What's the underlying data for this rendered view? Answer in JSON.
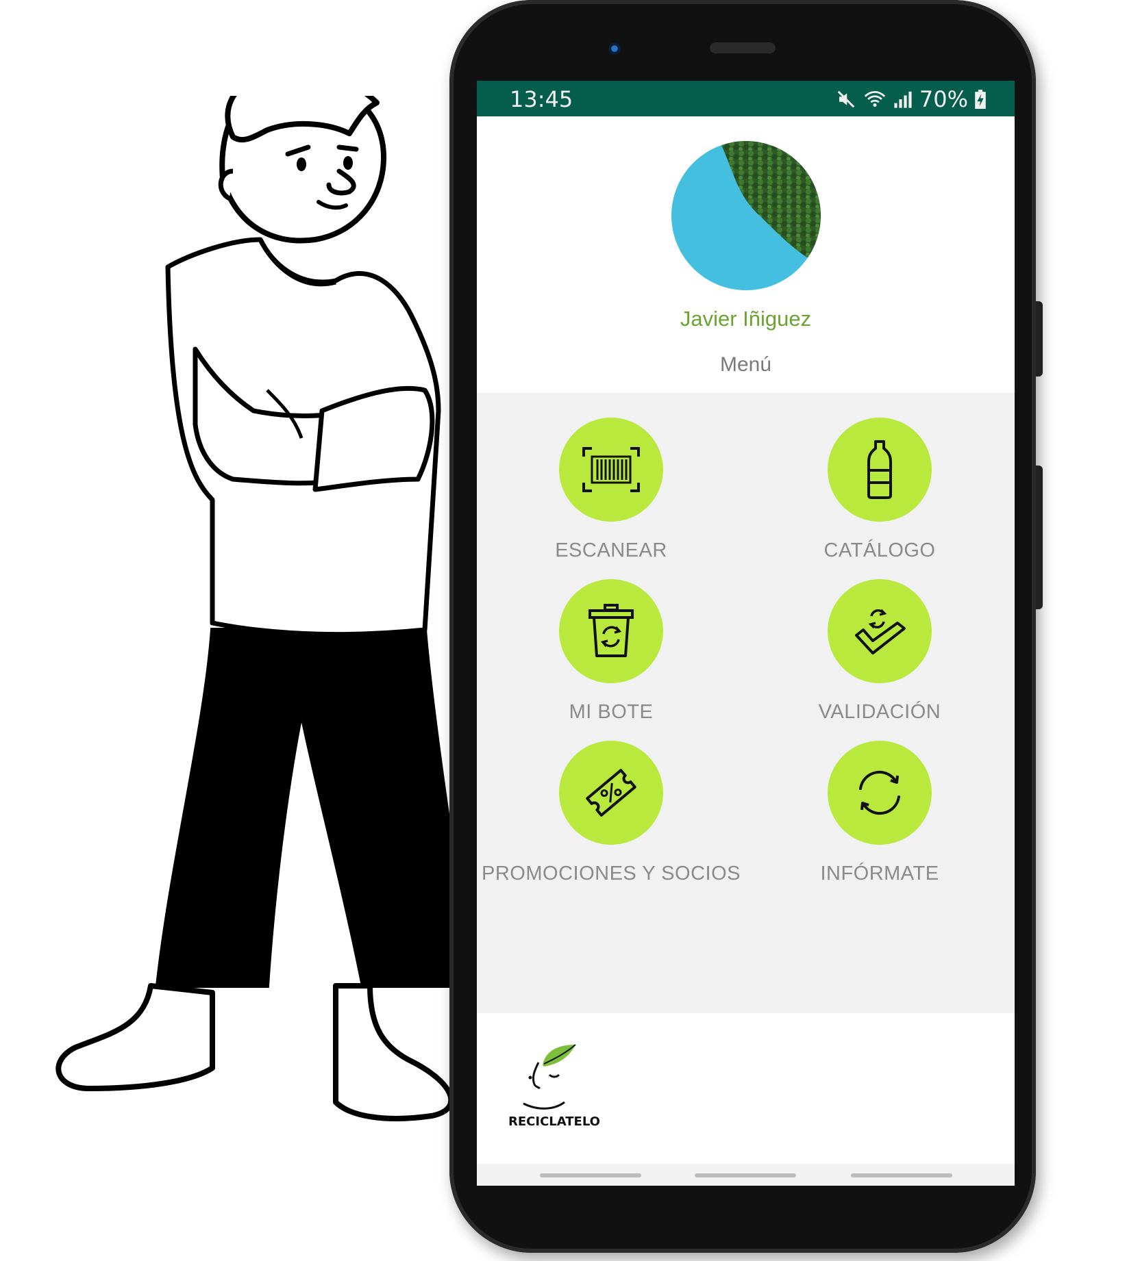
{
  "status_bar": {
    "time": "13:45",
    "battery": "70%",
    "icons": [
      "mute-icon",
      "wifi-icon",
      "signal-icon",
      "battery-charging-icon"
    ]
  },
  "profile": {
    "name": "Javier Iñiguez",
    "avatar": "lake-forest-aerial-photo"
  },
  "menu": {
    "title": "Menú",
    "items": [
      {
        "label": "ESCANEAR",
        "icon": "barcode-scan-icon"
      },
      {
        "label": "CATÁLOGO",
        "icon": "bottle-icon"
      },
      {
        "label": "MI BOTE",
        "icon": "recycle-bin-icon"
      },
      {
        "label": "VALIDACIÓN",
        "icon": "check-recycle-icon"
      },
      {
        "label": "PROMOCIONES Y SOCIOS",
        "icon": "discount-ticket-icon"
      },
      {
        "label": "INFÓRMATE",
        "icon": "refresh-icon"
      }
    ]
  },
  "footer": {
    "logo_text": "RECICLATELO"
  },
  "colors": {
    "status_bar": "#055e4b",
    "accent_green": "#b8e93c",
    "name_green": "#6aa431",
    "label_gray": "#8a8a8a",
    "grid_bg": "#f1f1f1"
  }
}
